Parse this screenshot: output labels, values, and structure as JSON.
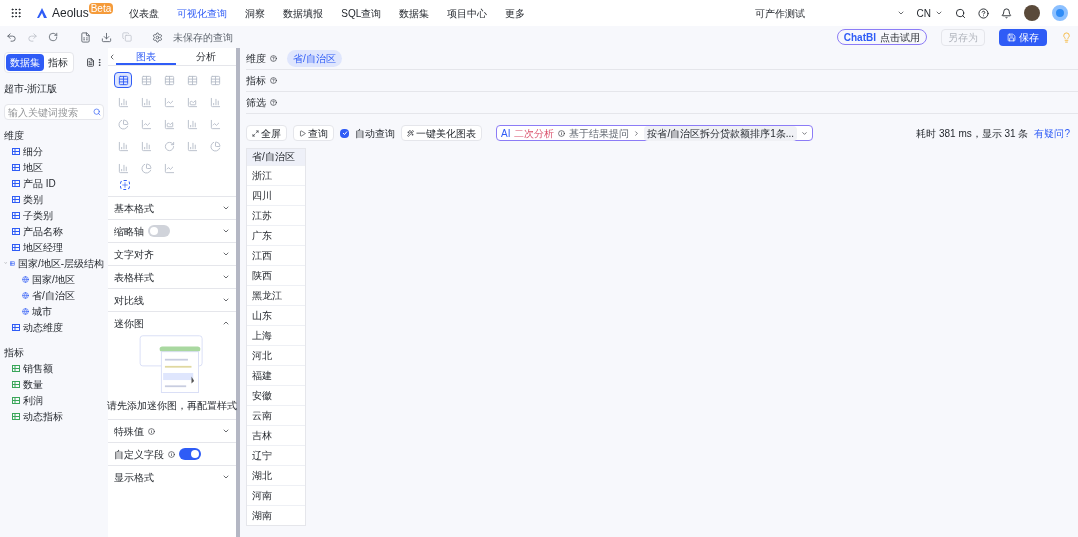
{
  "app": {
    "name": "Aeolus",
    "badge": "Beta"
  },
  "nav": [
    {
      "label": "仪表盘",
      "selected": false
    },
    {
      "label": "可视化查询",
      "selected": true
    },
    {
      "label": "洞察",
      "selected": false
    },
    {
      "label": "数据填报",
      "selected": false
    },
    {
      "label": "SQL查询",
      "selected": false
    },
    {
      "label": "数据集",
      "selected": false
    },
    {
      "label": "项目中心",
      "selected": false
    },
    {
      "label": "更多",
      "selected": false
    }
  ],
  "project": "可产作测试",
  "language": "CN",
  "toolbar": {
    "query_name": "未保存的查询",
    "chatbi": "ChatBI",
    "chatbi_hint": "点击试用",
    "save_as": "另存为",
    "save": "保存"
  },
  "left_tabs": [
    {
      "label": "数据集",
      "selected": true
    },
    {
      "label": "指标",
      "selected": false
    }
  ],
  "dataset": "超市-浙江版",
  "search": {
    "placeholder": "输入关键词搜索"
  },
  "dimensions": {
    "title": "维度",
    "items": [
      {
        "label": "细分"
      },
      {
        "label": "地区"
      },
      {
        "label": "产品 ID"
      },
      {
        "label": "类别"
      },
      {
        "label": "子类别"
      },
      {
        "label": "产品名称"
      },
      {
        "label": "地区经理"
      },
      {
        "label": "国家/地区-层级结构",
        "expanded": true,
        "children": [
          {
            "label": "国家/地区"
          },
          {
            "label": "省/自治区"
          },
          {
            "label": "城市"
          }
        ]
      },
      {
        "label": "动态维度"
      }
    ]
  },
  "measures": {
    "title": "指标",
    "items": [
      {
        "label": "销售额"
      },
      {
        "label": "数量"
      },
      {
        "label": "利润"
      },
      {
        "label": "动态指标"
      }
    ]
  },
  "mid_tabs": [
    {
      "label": "图表",
      "selected": true
    },
    {
      "label": "分析",
      "selected": false
    }
  ],
  "chart_types": [
    {
      "selected": true
    },
    {
      "selected": false
    },
    {
      "selected": false
    },
    {
      "selected": false
    },
    {
      "selected": false
    },
    {
      "selected": false
    },
    {
      "selected": false
    },
    {
      "selected": false
    },
    {
      "selected": false
    },
    {
      "selected": false
    },
    {
      "selected": false
    },
    {
      "selected": false
    },
    {
      "selected": false
    },
    {
      "selected": false
    },
    {
      "selected": false
    },
    {
      "selected": false
    },
    {
      "selected": false
    },
    {
      "selected": false
    },
    {
      "selected": false
    },
    {
      "selected": false
    },
    {
      "selected": false
    },
    {
      "selected": false
    },
    {
      "selected": false
    }
  ],
  "sections": [
    {
      "label": "基本格式",
      "kind": "plain",
      "expanded": false
    },
    {
      "label": "缩略轴",
      "kind": "toggle",
      "on": false,
      "expanded": false
    },
    {
      "label": "文字对齐",
      "kind": "plain",
      "expanded": false
    },
    {
      "label": "表格样式",
      "kind": "plain",
      "expanded": false
    },
    {
      "label": "对比线",
      "kind": "plain",
      "expanded": false
    },
    {
      "label": "迷你图",
      "kind": "plain",
      "expanded": true,
      "hint": "请先添加迷你图，再配置样式"
    },
    {
      "label": "特殊值",
      "kind": "info",
      "expanded": false
    },
    {
      "label": "自定义字段",
      "kind": "info-toggle",
      "on": true
    },
    {
      "label": "显示格式",
      "kind": "plain",
      "expanded": false
    }
  ],
  "shelves": [
    {
      "label": "维度",
      "chips": [
        "省/自治区"
      ]
    },
    {
      "label": "指标"
    },
    {
      "label": "筛选"
    }
  ],
  "actions": {
    "fullscreen": "全屏",
    "query": "查询",
    "auto_query": {
      "label": "自动查询",
      "checked": true
    },
    "beautify": "一键美化图表",
    "ai": "AI",
    "ai_label": "二次分析",
    "ai_hint": "基于结果提问",
    "ai_question": "按省/自治区拆分贷款额排序1条..."
  },
  "stats": "耗时 381 ms，显示 31 条",
  "help": "有疑问?",
  "table": {
    "column": "省/自治区",
    "rows": [
      "浙江",
      "四川",
      "江苏",
      "广东",
      "江西",
      "陕西",
      "黑龙江",
      "山东",
      "上海",
      "河北",
      "福建",
      "安徽",
      "云南",
      "吉林",
      "辽宁",
      "湖北",
      "河南",
      "湖南"
    ]
  }
}
